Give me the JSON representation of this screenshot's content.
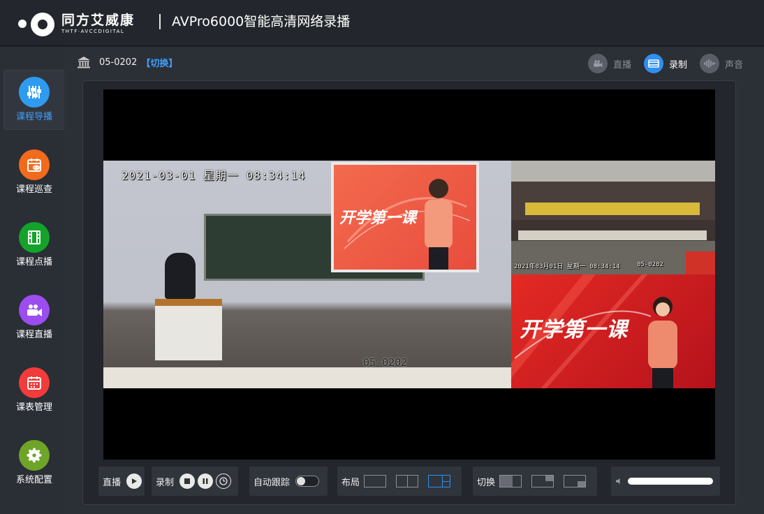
{
  "header": {
    "logo_cn": "同方艾威康",
    "logo_en": "THTF·AVCCDIGITAL",
    "app_title": "AVPro6000智能高清网络录播"
  },
  "sidebar": {
    "items": [
      {
        "label": "课程导播",
        "icon": "sliders-icon",
        "color": "#2f9bf0",
        "active": true
      },
      {
        "label": "课程巡查",
        "icon": "calendar-eye-icon",
        "color": "#f26b1d",
        "active": false
      },
      {
        "label": "课程点播",
        "icon": "film-icon",
        "color": "#13a32a",
        "active": false
      },
      {
        "label": "课程直播",
        "icon": "video-camera-icon",
        "color": "#9b4df0",
        "active": false
      },
      {
        "label": "课表管理",
        "icon": "calendar-icon",
        "color": "#f23b3b",
        "active": false
      },
      {
        "label": "系统配置",
        "icon": "gear-icon",
        "color": "#6ea427",
        "active": false
      }
    ]
  },
  "room": {
    "id": "05-0202",
    "switch_label": "【切换】"
  },
  "modes": [
    {
      "label": "直播",
      "state": "off"
    },
    {
      "label": "录制",
      "state": "on"
    },
    {
      "label": "声音",
      "state": "off"
    }
  ],
  "video": {
    "osd_main": "2021-03-01 星期一 08:34:14",
    "osd_room": "05-0202",
    "osd_class_date": "2021年03月01日 星期一 08:34:14",
    "osd_class_room": "05-0202",
    "ppt_title": "开学第一课"
  },
  "controls": {
    "live_label": "直播",
    "record_label": "录制",
    "auto_track_label": "自动跟踪",
    "layout_label": "布局",
    "switch_label": "切换"
  },
  "colors": {
    "accent": "#2f8ff0",
    "link": "#3ea0ff"
  }
}
